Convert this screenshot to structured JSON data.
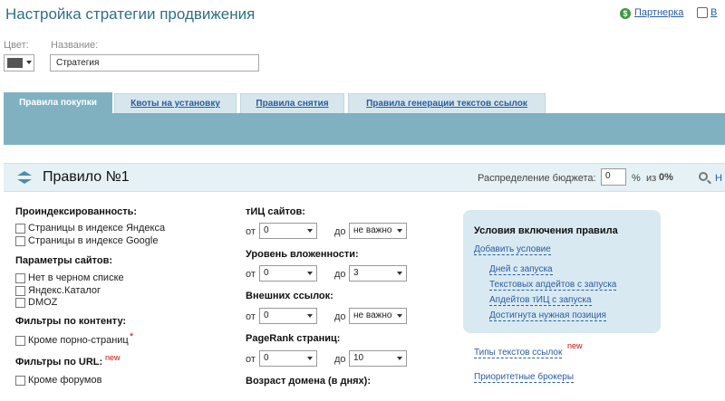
{
  "header": {
    "title": "Настройка стратегии продвижения",
    "partner_icon": "partner-icon",
    "partner_label": "Партнерка",
    "exit_label": "В"
  },
  "form": {
    "color_label": "Цвет:",
    "color_value": "#555555",
    "name_label": "Название:",
    "name_value": "Стратегия"
  },
  "tabs": [
    {
      "label": "Правила покупки",
      "active": true
    },
    {
      "label": "Квоты на установку",
      "active": false
    },
    {
      "label": "Правила снятия",
      "active": false
    },
    {
      "label": "Правила генерации текстов ссылок",
      "active": false
    }
  ],
  "rule": {
    "title": "Правило №1",
    "budget_label": "Распределение бюджета:",
    "budget_value": "0",
    "budget_pct": "%",
    "budget_of": "из",
    "budget_total": "0%",
    "search_label": "Н"
  },
  "left": {
    "indexation_title": "Проиндексированность:",
    "indexation_items": [
      "Страницы в индексе Яндекса",
      "Страницы в индексе Google"
    ],
    "sites_title": "Параметры сайтов:",
    "sites_items": [
      "Нет в черном списке",
      "Яндекс.Каталог",
      "DMOZ"
    ],
    "content_title": "Фильтры по контенту:",
    "content_item": "Кроме порно-страниц",
    "content_star": "*",
    "url_title": "Фильтры по URL:",
    "url_new": "new",
    "url_item": "Кроме форумов"
  },
  "middle": {
    "tic_title": "тИЦ сайтов:",
    "tic_from_label": "от",
    "tic_from": "0",
    "tic_to_label": "до",
    "tic_to": "не важно",
    "depth_title": "Уровень вложенности:",
    "depth_from_label": "от",
    "depth_from": "0",
    "depth_to_label": "до",
    "depth_to": "3",
    "ext_title": "Внешних ссылок:",
    "ext_from_label": "от",
    "ext_from": "0",
    "ext_to_label": "до",
    "ext_to": "не важно",
    "pr_title": "PageRank страниц:",
    "pr_from_label": "от",
    "pr_from": "0",
    "pr_to_label": "до",
    "pr_to": "10",
    "age_title": "Возраст домена (в днях):"
  },
  "conditions": {
    "title": "Условия включения правила",
    "add_label": "Добавить условие",
    "items": [
      "Дней с запуска",
      "Текстовых апдейтов с запуска",
      "Апдейтов тИЦ с запуска",
      "Достигнута нужная позиция"
    ],
    "types_label": "Типы текстов ссылок",
    "types_new": "new",
    "brokers_label": "Приоритетные брокеры"
  }
}
